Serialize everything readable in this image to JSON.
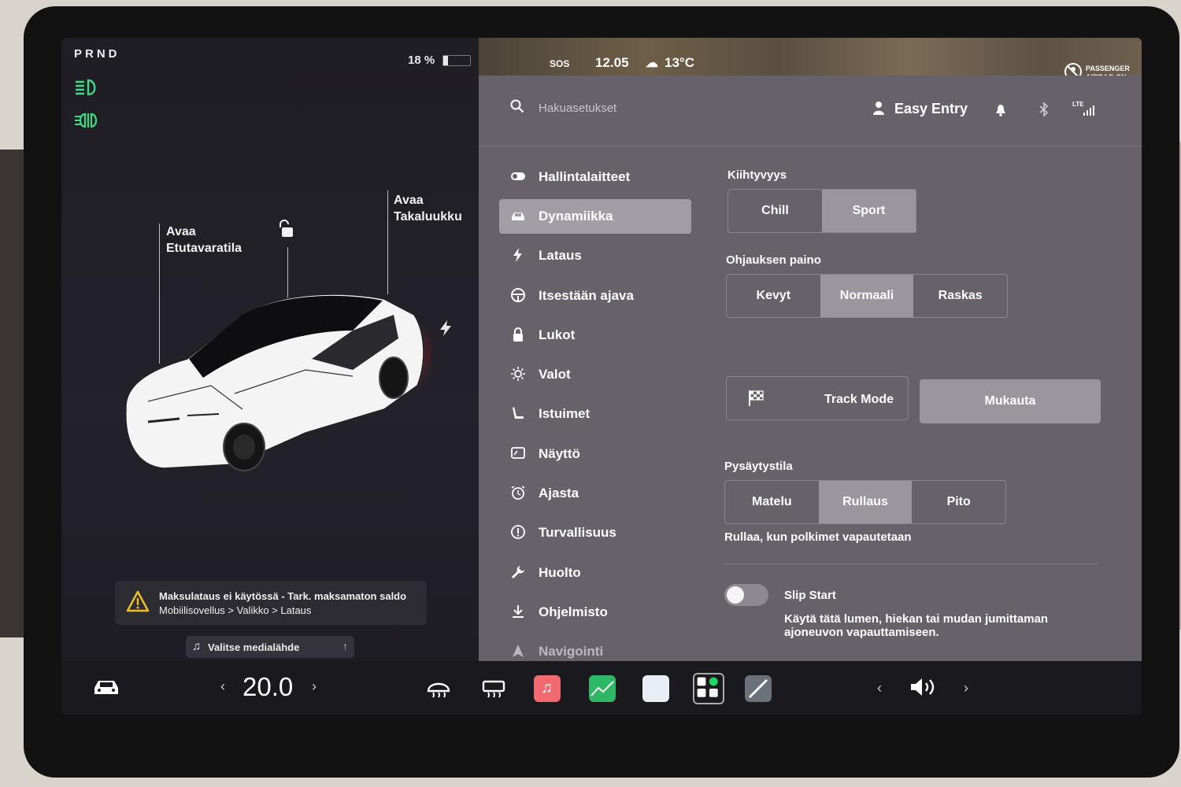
{
  "status": {
    "gear": "PRND",
    "battery_text": "18 %",
    "battery_percent": 18,
    "time": "12.05",
    "temperature": "13°C",
    "sos": "SOS",
    "airbag_line1": "PASSENGER",
    "airbag_line2": "AIRBAG ON"
  },
  "car": {
    "frunk_line1": "Avaa",
    "frunk_line2": "Etutavaratila",
    "trunk_line1": "Avaa",
    "trunk_line2": "Takaluukku",
    "alert_line1": "Maksulataus ei käytössä - Tark. maksamaton saldo",
    "alert_line2": "Mobiilisovellus > Valikko > Lataus",
    "media_label": "Valitse medialähde"
  },
  "header": {
    "search_placeholder": "Hakuasetukset",
    "profile_name": "Easy Entry",
    "lte": "LTE"
  },
  "nav": {
    "items": [
      {
        "label": "Hallintalaitteet",
        "icon": "toggle-icon"
      },
      {
        "label": "Dynamiikka",
        "icon": "car-icon"
      },
      {
        "label": "Lataus",
        "icon": "lightning-icon"
      },
      {
        "label": "Itsestään ajava",
        "icon": "steering-wheel-icon"
      },
      {
        "label": "Lukot",
        "icon": "lock-icon"
      },
      {
        "label": "Valot",
        "icon": "sun-icon"
      },
      {
        "label": "Istuimet",
        "icon": "seat-icon"
      },
      {
        "label": "Näyttö",
        "icon": "display-icon"
      },
      {
        "label": "Ajasta",
        "icon": "alarm-clock-icon"
      },
      {
        "label": "Turvallisuus",
        "icon": "info-circle-icon"
      },
      {
        "label": "Huolto",
        "icon": "wrench-icon"
      },
      {
        "label": "Ohjelmisto",
        "icon": "download-icon"
      },
      {
        "label": "Navigointi",
        "icon": "navigation-icon"
      }
    ],
    "active_index": 1
  },
  "dynamics": {
    "acceleration": {
      "title": "Kiihtyvyys",
      "options": [
        "Chill",
        "Sport"
      ],
      "selected": "Sport"
    },
    "steering": {
      "title": "Ohjauksen paino",
      "options": [
        "Kevyt",
        "Normaali",
        "Raskas"
      ],
      "selected": "Normaali"
    },
    "track_mode_label": "Track Mode",
    "customize_label": "Mukauta",
    "stopping": {
      "title": "Pysäytystila",
      "options": [
        "Matelu",
        "Rullaus",
        "Pito"
      ],
      "selected": "Rullaus",
      "description": "Rullaa, kun polkimet vapautetaan"
    },
    "slip_start": {
      "title": "Slip Start",
      "enabled": false,
      "description": "Käytä tätä lumen, hiekan tai mudan jumittaman ajoneuvon vapauttamiseen."
    }
  },
  "bottom": {
    "temp_left": "‹",
    "temperature": "20.0",
    "temp_right": "›",
    "vol_left": "‹",
    "vol_right": "›"
  },
  "colors": {
    "settings_bg": "#67626a",
    "selected_segment": "#9b959e",
    "lamp_green": "#3ddc84"
  }
}
